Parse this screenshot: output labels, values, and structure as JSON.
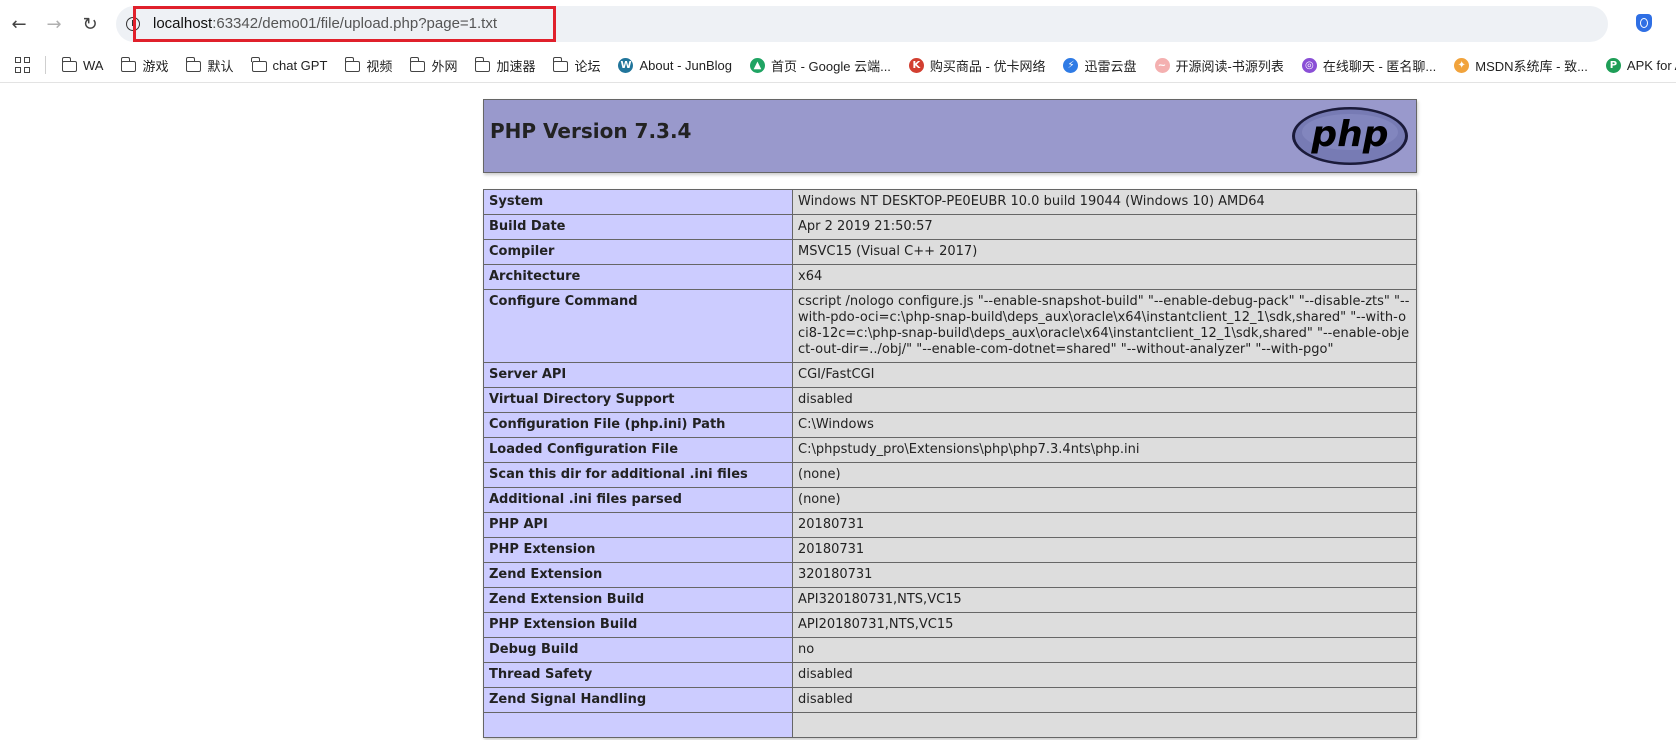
{
  "browser": {
    "url_host": "localhost",
    "url_rest": ":63342/demo01/file/upload.php?page=1.txt",
    "highlight_color": "#e0202b"
  },
  "bookmarks": [
    {
      "label": "WA",
      "icon": "folder-icon"
    },
    {
      "label": "游戏",
      "icon": "folder-icon"
    },
    {
      "label": "默认",
      "icon": "folder-icon"
    },
    {
      "label": "chat GPT",
      "icon": "folder-icon"
    },
    {
      "label": "视频",
      "icon": "folder-icon"
    },
    {
      "label": "外网",
      "icon": "folder-icon"
    },
    {
      "label": "加速器",
      "icon": "folder-icon"
    },
    {
      "label": "论坛",
      "icon": "folder-icon"
    },
    {
      "label": "About - JunBlog",
      "icon": "wordpress-icon"
    },
    {
      "label": "首页 - Google 云端...",
      "icon": "google-drive-icon"
    },
    {
      "label": "购买商品 - 优卡网络",
      "icon": "shop-icon"
    },
    {
      "label": "迅雷云盘",
      "icon": "thunder-icon"
    },
    {
      "label": "开源阅读-书源列表",
      "icon": "reader-icon"
    },
    {
      "label": "在线聊天 - 匿名聊...",
      "icon": "chat-icon"
    },
    {
      "label": "MSDN系统库 - 致...",
      "icon": "msdn-icon"
    },
    {
      "label": "APK for An",
      "icon": "apk-icon"
    }
  ],
  "phpinfo": {
    "title": "PHP Version 7.3.4",
    "logo_text": "php",
    "header_color": "#9999cc",
    "key_color": "#ccccff",
    "value_color": "#dddddd",
    "rows": [
      {
        "key": "System",
        "value": "Windows NT DESKTOP-PE0EUBR 10.0 build 19044 (Windows 10) AMD64"
      },
      {
        "key": "Build Date",
        "value": "Apr 2 2019 21:50:57"
      },
      {
        "key": "Compiler",
        "value": "MSVC15 (Visual C++ 2017)"
      },
      {
        "key": "Architecture",
        "value": "x64"
      },
      {
        "key": "Configure Command",
        "value": "cscript /nologo configure.js \"--enable-snapshot-build\" \"--enable-debug-pack\" \"--disable-zts\" \"--with-pdo-oci=c:\\php-snap-build\\deps_aux\\oracle\\x64\\instantclient_12_1\\sdk,shared\" \"--with-oci8-12c=c:\\php-snap-build\\deps_aux\\oracle\\x64\\instantclient_12_1\\sdk,shared\" \"--enable-object-out-dir=../obj/\" \"--enable-com-dotnet=shared\" \"--without-analyzer\" \"--with-pgo\""
      },
      {
        "key": "Server API",
        "value": "CGI/FastCGI"
      },
      {
        "key": "Virtual Directory Support",
        "value": "disabled"
      },
      {
        "key": "Configuration File (php.ini) Path",
        "value": "C:\\Windows"
      },
      {
        "key": "Loaded Configuration File",
        "value": "C:\\phpstudy_pro\\Extensions\\php\\php7.3.4nts\\php.ini"
      },
      {
        "key": "Scan this dir for additional .ini files",
        "value": "(none)"
      },
      {
        "key": "Additional .ini files parsed",
        "value": "(none)"
      },
      {
        "key": "PHP API",
        "value": "20180731"
      },
      {
        "key": "PHP Extension",
        "value": "20180731"
      },
      {
        "key": "Zend Extension",
        "value": "320180731"
      },
      {
        "key": "Zend Extension Build",
        "value": "API320180731,NTS,VC15"
      },
      {
        "key": "PHP Extension Build",
        "value": "API20180731,NTS,VC15"
      },
      {
        "key": "Debug Build",
        "value": "no"
      },
      {
        "key": "Thread Safety",
        "value": "disabled"
      },
      {
        "key": "Zend Signal Handling",
        "value": "disabled"
      },
      {
        "key": "",
        "value": ""
      }
    ]
  }
}
